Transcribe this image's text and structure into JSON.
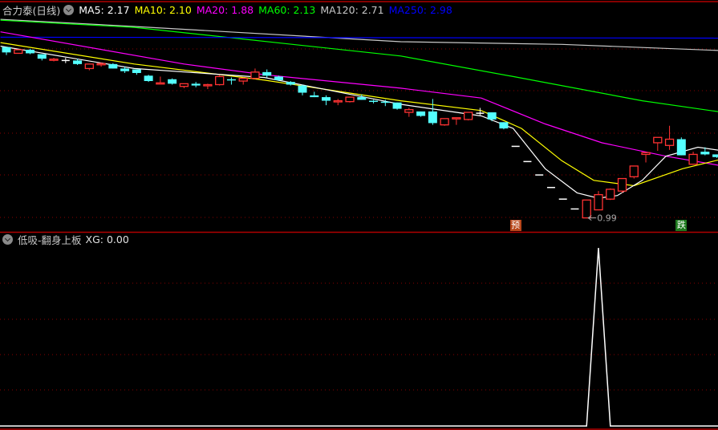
{
  "header": {
    "title": "合力泰(日线)",
    "ma_labels": [
      {
        "text": "MA5: 2.17",
        "color": "#ffffff"
      },
      {
        "text": "MA10: 2.10",
        "color": "#ffff00"
      },
      {
        "text": "MA20: 1.88",
        "color": "#ff00ff"
      },
      {
        "text": "MA60: 2.13",
        "color": "#00ff00"
      },
      {
        "text": "MA120: 2.71",
        "color": "#c8c8c8"
      },
      {
        "text": "MA250: 2.98",
        "color": "#0000ff"
      }
    ]
  },
  "indicator": {
    "name": "低吸-翻身上板",
    "value_label": "XG: 0.00"
  },
  "markers": {
    "pre": "预",
    "fall": "跌",
    "low_label": "0.99"
  },
  "chart_data": [
    {
      "type": "candlestick",
      "title": "合力泰(日线)",
      "candles_ohlc": [
        [
          2.9,
          2.9,
          2.81,
          2.84
        ],
        [
          2.83,
          2.87,
          2.83,
          2.87
        ],
        [
          2.87,
          2.88,
          2.82,
          2.83
        ],
        [
          2.82,
          2.82,
          2.75,
          2.77
        ],
        [
          2.76,
          2.78,
          2.74,
          2.765
        ],
        [
          2.75,
          2.78,
          2.72,
          2.75
        ],
        [
          2.75,
          2.77,
          2.7,
          2.71
        ],
        [
          2.66,
          2.71,
          2.64,
          2.71
        ],
        [
          2.71,
          2.73,
          2.68,
          2.715
        ],
        [
          2.71,
          2.72,
          2.66,
          2.66
        ],
        [
          2.66,
          2.68,
          2.61,
          2.63
        ],
        [
          2.65,
          2.65,
          2.59,
          2.61
        ],
        [
          2.58,
          2.59,
          2.51,
          2.52
        ],
        [
          2.49,
          2.57,
          2.49,
          2.5
        ],
        [
          2.54,
          2.55,
          2.48,
          2.49
        ],
        [
          2.46,
          2.49,
          2.44,
          2.49
        ],
        [
          2.49,
          2.51,
          2.45,
          2.47
        ],
        [
          2.47,
          2.49,
          2.43,
          2.48
        ],
        [
          2.48,
          2.59,
          2.47,
          2.57
        ],
        [
          2.54,
          2.56,
          2.48,
          2.53
        ],
        [
          2.52,
          2.56,
          2.48,
          2.55
        ],
        [
          2.55,
          2.66,
          2.54,
          2.62
        ],
        [
          2.62,
          2.65,
          2.56,
          2.58
        ],
        [
          2.57,
          2.58,
          2.52,
          2.53
        ],
        [
          2.51,
          2.52,
          2.47,
          2.48
        ],
        [
          2.47,
          2.48,
          2.36,
          2.39
        ],
        [
          2.36,
          2.4,
          2.34,
          2.34
        ],
        [
          2.34,
          2.36,
          2.25,
          2.3
        ],
        [
          2.29,
          2.32,
          2.25,
          2.3
        ],
        [
          2.29,
          2.34,
          2.28,
          2.34
        ],
        [
          2.34,
          2.37,
          2.31,
          2.31
        ],
        [
          2.3,
          2.31,
          2.27,
          2.29
        ],
        [
          2.29,
          2.31,
          2.24,
          2.28
        ],
        [
          2.28,
          2.28,
          2.2,
          2.21
        ],
        [
          2.17,
          2.22,
          2.12,
          2.2
        ],
        [
          2.18,
          2.18,
          2.12,
          2.13
        ],
        [
          2.18,
          2.32,
          2.03,
          2.05
        ],
        [
          2.03,
          2.1,
          2.02,
          2.1
        ],
        [
          2.1,
          2.11,
          2.03,
          2.11
        ],
        [
          2.09,
          2.17,
          2.08,
          2.17
        ],
        [
          2.16,
          2.22,
          2.14,
          2.16
        ],
        [
          2.17,
          2.17,
          2.07,
          2.09
        ],
        [
          2.06,
          2.06,
          1.98,
          1.99
        ],
        [
          1.79,
          1.79,
          1.79,
          1.79
        ],
        [
          1.62,
          1.62,
          1.62,
          1.62
        ],
        [
          1.47,
          1.47,
          1.47,
          1.47
        ],
        [
          1.33,
          1.33,
          1.33,
          1.33
        ],
        [
          1.2,
          1.2,
          1.2,
          1.2
        ],
        [
          1.09,
          1.09,
          1.09,
          1.09
        ],
        [
          0.99,
          1.19,
          0.99,
          1.19
        ],
        [
          1.08,
          1.29,
          1.08,
          1.25
        ],
        [
          1.2,
          1.32,
          1.19,
          1.31
        ],
        [
          1.29,
          1.43,
          1.27,
          1.43
        ],
        [
          1.45,
          1.57,
          1.43,
          1.57
        ],
        [
          1.7,
          1.72,
          1.61,
          1.72
        ],
        [
          1.83,
          1.89,
          1.74,
          1.89
        ],
        [
          1.8,
          2.02,
          1.75,
          1.87
        ],
        [
          1.87,
          1.89,
          1.69,
          1.69
        ],
        [
          1.59,
          1.73,
          1.59,
          1.7
        ],
        [
          1.73,
          1.78,
          1.69,
          1.7
        ],
        [
          1.7,
          1.7,
          1.66,
          1.67
        ]
      ],
      "ohlc_order": "open,high,low,close",
      "moving_averages": [
        {
          "name": "MA120",
          "color": "#c8c8c8",
          "points": [
            [
              -0.5,
              3.21
            ],
            [
              10.8,
              3.13
            ],
            [
              33.3,
              2.96
            ],
            [
              46.9,
              2.93
            ],
            [
              60.5,
              2.86
            ]
          ]
        },
        {
          "name": "MA60",
          "color": "#00ff00",
          "points": [
            [
              -0.5,
              3.2
            ],
            [
              10.8,
              3.12
            ],
            [
              33.3,
              2.8
            ],
            [
              42.8,
              2.57
            ],
            [
              53.7,
              2.3
            ],
            [
              60.5,
              2.17
            ]
          ]
        },
        {
          "name": "MA250",
          "color": "#0000ff",
          "points": [
            [
              -0.5,
              3.01
            ],
            [
              60.5,
              3.0
            ]
          ]
        },
        {
          "name": "MA20",
          "color": "#ff00ff",
          "points": [
            [
              -0.5,
              3.07
            ],
            [
              15.0,
              2.71
            ],
            [
              21.8,
              2.59
            ],
            [
              33.3,
              2.44
            ],
            [
              40.1,
              2.33
            ],
            [
              45.5,
              2.04
            ],
            [
              50.3,
              1.83
            ],
            [
              55.7,
              1.68
            ],
            [
              60.5,
              1.57
            ]
          ]
        },
        {
          "name": "MA10",
          "color": "#ffff00",
          "points": [
            [
              -0.5,
              2.95
            ],
            [
              10.8,
              2.71
            ],
            [
              21.8,
              2.53
            ],
            [
              33.3,
              2.3
            ],
            [
              40.1,
              2.19
            ],
            [
              43.5,
              1.99
            ],
            [
              46.9,
              1.63
            ],
            [
              49.6,
              1.41
            ],
            [
              53.0,
              1.35
            ],
            [
              57.1,
              1.54
            ],
            [
              60.5,
              1.65
            ]
          ]
        },
        {
          "name": "MA5",
          "color": "#ffffff",
          "points": [
            [
              -0.5,
              2.91
            ],
            [
              10.8,
              2.66
            ],
            [
              21.8,
              2.56
            ],
            [
              33.3,
              2.26
            ],
            [
              40.1,
              2.13
            ],
            [
              42.8,
              1.99
            ],
            [
              45.5,
              1.54
            ],
            [
              48.2,
              1.27
            ],
            [
              50.0,
              1.21
            ],
            [
              51.6,
              1.24
            ],
            [
              53.7,
              1.41
            ],
            [
              55.7,
              1.68
            ],
            [
              58.4,
              1.78
            ],
            [
              60.5,
              1.74
            ]
          ]
        }
      ],
      "low_point": {
        "index": 49,
        "value": 0.99
      },
      "signal_markers": [
        {
          "index": 43,
          "label_key": "pre"
        },
        {
          "index": 57,
          "label_key": "fall"
        }
      ],
      "up_color": "#ff3232",
      "down_color": "#54ffff",
      "grid": true
    },
    {
      "type": "line",
      "title": "低吸-翻身上板",
      "series": [
        {
          "name": "XG",
          "color": "#ffffff",
          "spike_index": 50,
          "spike_value": 1,
          "base_value": 0
        }
      ],
      "count": 61,
      "ylim": [
        0,
        1
      ]
    }
  ]
}
